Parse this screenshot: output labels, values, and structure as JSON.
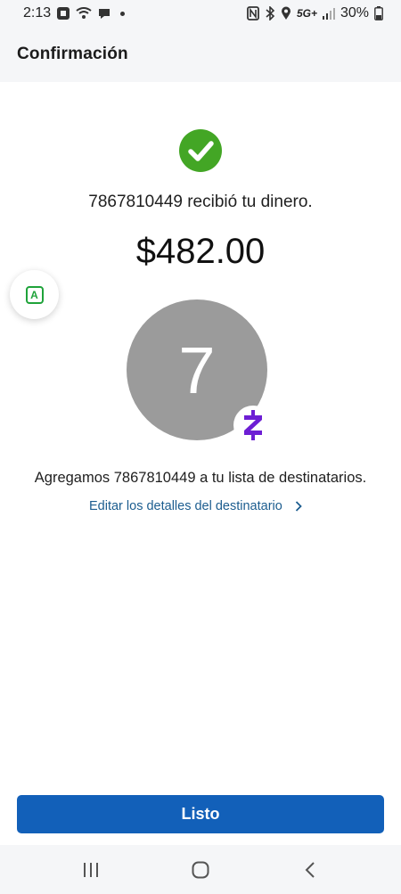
{
  "status_bar": {
    "time": "2:13",
    "network": "5G+",
    "battery_percent": "30%",
    "icons": [
      "bank-icon",
      "wifi-icon",
      "chat-icon",
      "nfc-icon",
      "bluetooth-icon",
      "location-icon",
      "signal-icon",
      "battery-icon"
    ]
  },
  "header": {
    "title": "Confirmación"
  },
  "confirmation": {
    "recipient_message": "7867810449 recibió tu dinero.",
    "amount": "$482.00",
    "avatar_initial": "7",
    "added_message": "Agregamos 7867810449 a tu lista de destinatarios.",
    "edit_link": "Editar los detalles del destinatario"
  },
  "floating_button": {
    "label": "A"
  },
  "actions": {
    "done_label": "Listo"
  },
  "colors": {
    "success_green": "#43a625",
    "primary_blue": "#1260b9",
    "link_blue": "#1c5d8f",
    "zelle_purple": "#6d1ed4",
    "avatar_gray": "#9b9b9b"
  }
}
